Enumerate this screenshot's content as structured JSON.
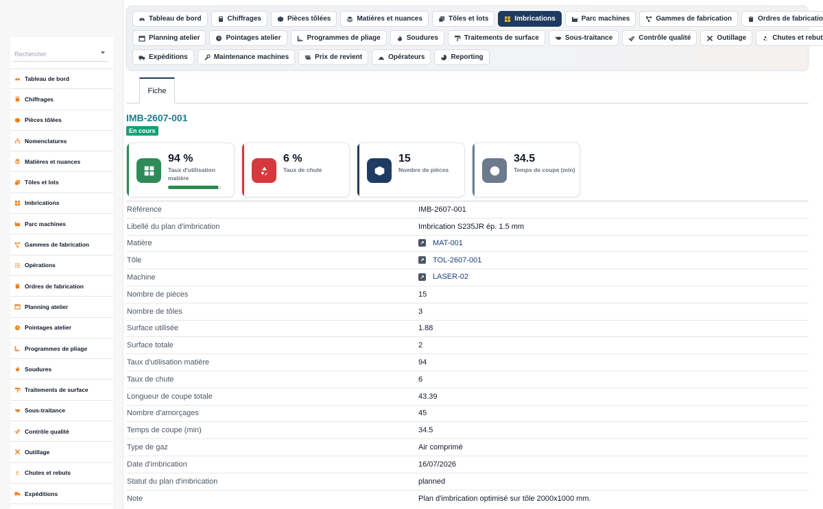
{
  "sidebar": {
    "search_placeholder": "Rechercher",
    "items": [
      {
        "label": "Tableau de bord",
        "icon": "dashboard-icon"
      },
      {
        "label": "Chiffrages",
        "icon": "calculator-icon"
      },
      {
        "label": "Pièces tôlées",
        "icon": "box-icon"
      },
      {
        "label": "Nomenclatures",
        "icon": "hierarchy-icon"
      },
      {
        "label": "Matières et nuances",
        "icon": "layers-icon"
      },
      {
        "label": "Tôles et lots",
        "icon": "copy-icon"
      },
      {
        "label": "Imbrications",
        "icon": "grid-icon"
      },
      {
        "label": "Parc machines",
        "icon": "factory-icon"
      },
      {
        "label": "Gammes de fabrication",
        "icon": "flow-icon"
      },
      {
        "label": "Opérations",
        "icon": "list-icon"
      },
      {
        "label": "Ordres de fabrication",
        "icon": "clipboard-icon"
      },
      {
        "label": "Planning atelier",
        "icon": "calendar-icon"
      },
      {
        "label": "Pointages atelier",
        "icon": "clock-icon"
      },
      {
        "label": "Programmes de pliage",
        "icon": "fold-icon"
      },
      {
        "label": "Soudures",
        "icon": "flame-icon"
      },
      {
        "label": "Traitements de surface",
        "icon": "paint-roller-icon"
      },
      {
        "label": "Sous-traitance",
        "icon": "handshake-icon"
      },
      {
        "label": "Contrôle qualité",
        "icon": "check-double-icon"
      },
      {
        "label": "Outillage",
        "icon": "tools-icon"
      },
      {
        "label": "Chutes et rebuts",
        "icon": "recycle-icon"
      },
      {
        "label": "Expéditions",
        "icon": "truck-icon"
      }
    ]
  },
  "tabs": {
    "row1": [
      {
        "label": "Tableau de bord",
        "icon": "dashboard-icon",
        "active": false
      },
      {
        "label": "Chiffrages",
        "icon": "calculator-icon",
        "active": false
      },
      {
        "label": "Pièces tôlées",
        "icon": "box-icon",
        "active": false
      },
      {
        "label": "Matières et nuances",
        "icon": "layers-icon",
        "active": false
      },
      {
        "label": "Tôles et lots",
        "icon": "copy-icon",
        "active": false
      },
      {
        "label": "Imbrications",
        "icon": "grid-icon",
        "active": true
      },
      {
        "label": "Parc machines",
        "icon": "factory-icon",
        "active": false
      },
      {
        "label": "Gammes de fabrication",
        "icon": "flow-icon",
        "active": false
      },
      {
        "label": "Ordres de fabrication",
        "icon": "clipboard-icon",
        "active": false
      }
    ],
    "row2": [
      {
        "label": "Planning atelier",
        "icon": "calendar-icon",
        "active": false
      },
      {
        "label": "Pointages atelier",
        "icon": "clock-icon",
        "active": false
      },
      {
        "label": "Programmes de pliage",
        "icon": "fold-icon",
        "active": false
      },
      {
        "label": "Soudures",
        "icon": "flame-icon",
        "active": false
      },
      {
        "label": "Traitements de surface",
        "icon": "paint-roller-icon",
        "active": false
      },
      {
        "label": "Sous-traitance",
        "icon": "handshake-icon",
        "active": false
      },
      {
        "label": "Contrôle qualité",
        "icon": "check-double-icon",
        "active": false
      },
      {
        "label": "Outillage",
        "icon": "tools-icon",
        "active": false
      },
      {
        "label": "Chutes et rebuts",
        "icon": "recycle-icon",
        "active": false
      }
    ],
    "row3": [
      {
        "label": "Expéditions",
        "icon": "truck-icon",
        "active": false
      },
      {
        "label": "Maintenance machines",
        "icon": "wrench-icon",
        "active": false
      },
      {
        "label": "Prix de revient",
        "icon": "money-icon",
        "active": false
      },
      {
        "label": "Opérateurs",
        "icon": "hardhat-icon",
        "active": false
      },
      {
        "label": "Reporting",
        "icon": "pie-icon",
        "active": false
      }
    ]
  },
  "subtab": {
    "label": "Fiche"
  },
  "record": {
    "title": "IMB-2607-001",
    "status": "En cours",
    "status_color": "#199f78",
    "title_color": "#1a7f8e"
  },
  "kpis": [
    {
      "value": "94 %",
      "label": "Taux d'utilisation matière",
      "icon": "grid-icon",
      "color": "#2e8b57",
      "progress": 94
    },
    {
      "value": "6 %",
      "label": "Taux de chute",
      "icon": "recycle-icon",
      "color": "#d6383d"
    },
    {
      "value": "15",
      "label": "Nombre de pièces",
      "icon": "box-icon",
      "color": "#1f3b63"
    },
    {
      "value": "34.5",
      "label": "Temps de coupe (min)",
      "icon": "clock-icon",
      "color": "#6b7a8c"
    }
  ],
  "fields": [
    {
      "key": "Référence",
      "value": "IMB-2607-001"
    },
    {
      "key": "Libellé du plan d'imbrication",
      "value": "Imbrication S235JR ép. 1.5 mm"
    },
    {
      "key": "Matière",
      "value": "MAT-001",
      "link": true
    },
    {
      "key": "Tôle",
      "value": "TOL-2607-001",
      "link": true
    },
    {
      "key": "Machine",
      "value": "LASER-02",
      "link": true
    },
    {
      "key": "Nombre de pièces",
      "value": "15"
    },
    {
      "key": "Nombre de tôles",
      "value": "3"
    },
    {
      "key": "Surface utilisée",
      "value": "1.88"
    },
    {
      "key": "Surface totale",
      "value": "2"
    },
    {
      "key": "Taux d'utilisation matière",
      "value": "94"
    },
    {
      "key": "Taux de chute",
      "value": "6"
    },
    {
      "key": "Longueur de coupe totale",
      "value": "43.39"
    },
    {
      "key": "Nombre d'amorçages",
      "value": "45"
    },
    {
      "key": "Temps de coupe (min)",
      "value": "34.5"
    },
    {
      "key": "Type de gaz",
      "value": "Air comprimé"
    },
    {
      "key": "Date d'imbrication",
      "value": "16/07/2026"
    },
    {
      "key": "Statut du plan d'imbrication",
      "value": "planned"
    },
    {
      "key": "Note",
      "value": "Plan d'imbrication optimisé sur tôle 2000x1000 mm."
    }
  ]
}
